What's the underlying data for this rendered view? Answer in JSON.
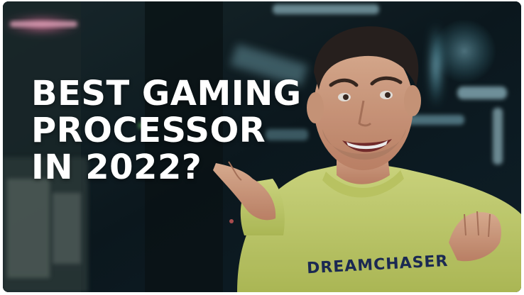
{
  "headline": {
    "line1": "BEST GAMING",
    "line2": "PROCESSOR",
    "line3": "IN 2022?"
  },
  "shirt_print": "DREAMCHASER",
  "colors": {
    "background_dark": "#0b1418",
    "neon_cyan": "#7fd3e6",
    "neon_pink": "#e6588f",
    "sweater_lime": "#d4e07a",
    "shirt_print_navy": "#1e2d59",
    "headline_text": "#ffffff"
  }
}
